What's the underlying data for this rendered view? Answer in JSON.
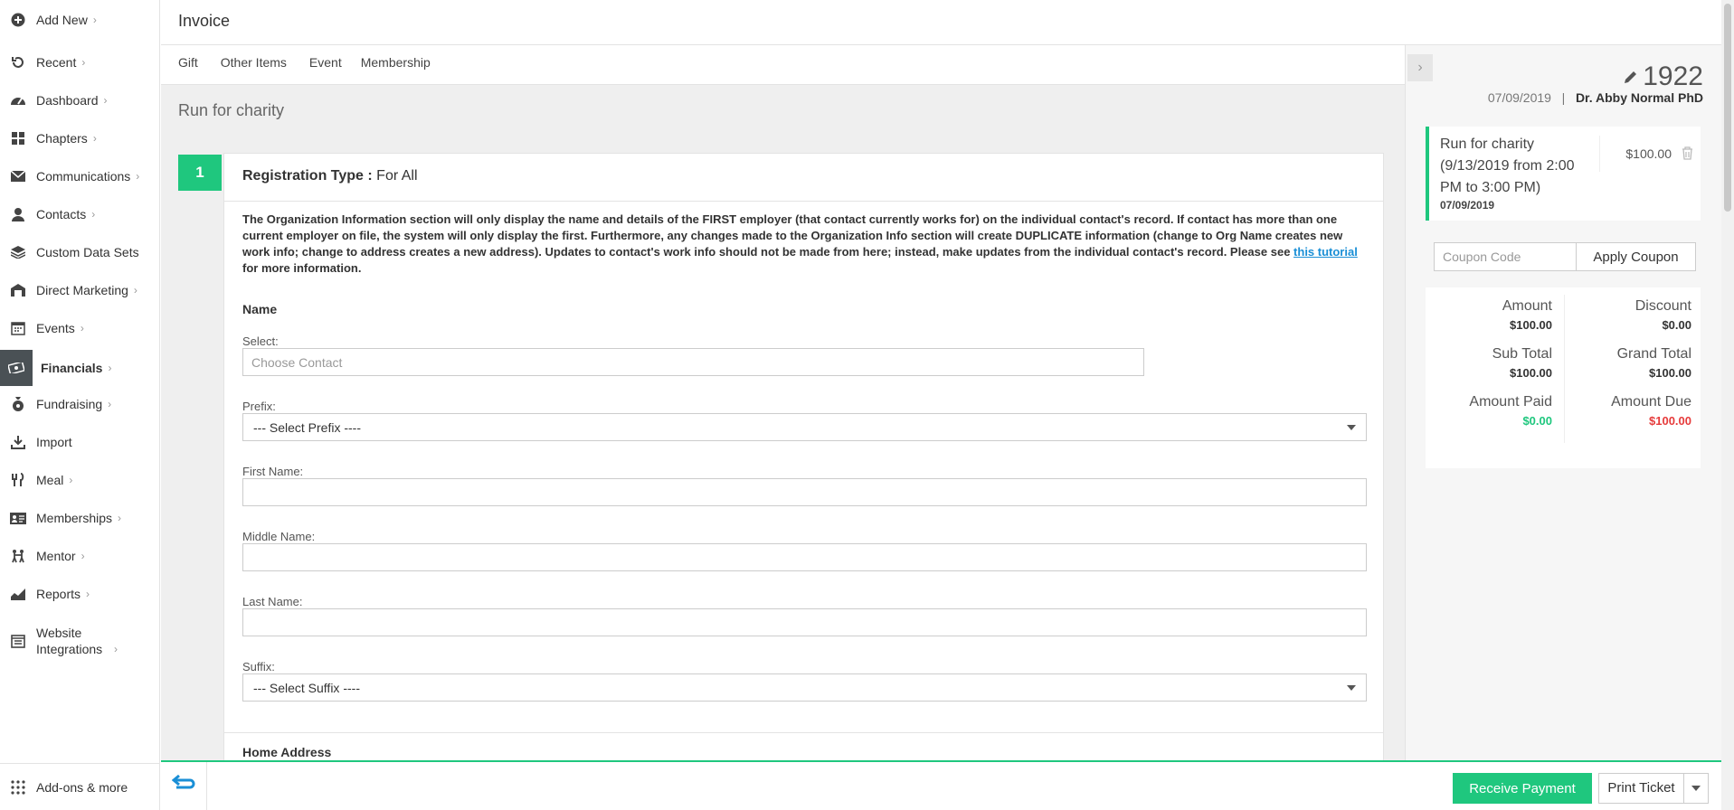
{
  "sidebar": {
    "items": [
      {
        "label": "Add New",
        "icon": "plus-circle-icon"
      },
      {
        "label": "Recent",
        "icon": "history-icon"
      },
      {
        "label": "Dashboard",
        "icon": "dashboard-icon"
      },
      {
        "label": "Chapters",
        "icon": "grid-icon"
      },
      {
        "label": "Communications",
        "icon": "envelope-icon"
      },
      {
        "label": "Contacts",
        "icon": "person-icon"
      },
      {
        "label": "Custom Data Sets",
        "icon": "layers-icon"
      },
      {
        "label": "Direct Marketing",
        "icon": "building-icon"
      },
      {
        "label": "Events",
        "icon": "calendar-icon"
      },
      {
        "label": "Financials",
        "icon": "money-icon"
      },
      {
        "label": "Fundraising",
        "icon": "moneybag-icon"
      },
      {
        "label": "Import",
        "icon": "import-icon"
      },
      {
        "label": "Meal",
        "icon": "utensils-icon"
      },
      {
        "label": "Memberships",
        "icon": "id-card-icon"
      },
      {
        "label": "Mentor",
        "icon": "mentor-icon"
      },
      {
        "label": "Reports",
        "icon": "chart-icon"
      },
      {
        "label": "Website Integrations",
        "icon": "website-icon"
      }
    ],
    "bottom_label": "Add-ons & more"
  },
  "header": {
    "title": "Invoice"
  },
  "tabs": [
    {
      "label": "Gift"
    },
    {
      "label": "Other Items"
    },
    {
      "label": "Event"
    },
    {
      "label": "Membership"
    }
  ],
  "main": {
    "event_title": "Run for charity",
    "step_number": "1",
    "registration_type_label": "Registration Type :",
    "registration_type_value": "For All",
    "notice_text": "The Organization Information section will only display the name and details of the FIRST employer (that contact currently works for) on the individual contact's record. If contact has more than one current employer on file, the system will only display the first. Furthermore, any changes made to the Organization Info section will create DUPLICATE information (change to Org Name creates new work info; change to address creates a new address). Updates to contact's work info should not be made from here; instead, make updates from the individual contact's record. Please see",
    "notice_link": "this tutorial",
    "notice_tail": "for more information.",
    "name_section": "Name",
    "select_label": "Select:",
    "select_placeholder": "Choose Contact",
    "prefix_label": "Prefix:",
    "prefix_value": "--- Select Prefix ----",
    "first_name_label": "First Name:",
    "middle_name_label": "Middle Name:",
    "last_name_label": "Last Name:",
    "suffix_label": "Suffix:",
    "suffix_value": "--- Select Suffix ----",
    "home_address_section": "Home Address"
  },
  "panel": {
    "invoice_number": "1922",
    "date": "07/09/2019",
    "separator": "|",
    "contact": "Dr. Abby Normal PhD",
    "item": {
      "name": "Run for charity (9/13/2019 from 2:00 PM to 3:00 PM)",
      "date": "07/09/2019",
      "price": "$100.00"
    },
    "coupon_placeholder": "Coupon Code",
    "apply_coupon": "Apply Coupon",
    "totals": {
      "amount_label": "Amount",
      "amount": "$100.00",
      "discount_label": "Discount",
      "discount": "$0.00",
      "subtotal_label": "Sub Total",
      "subtotal": "$100.00",
      "grandtotal_label": "Grand Total",
      "grandtotal": "$100.00",
      "paid_label": "Amount Paid",
      "paid": "$0.00",
      "due_label": "Amount Due",
      "due": "$100.00"
    }
  },
  "footer": {
    "receive_payment": "Receive Payment",
    "print_ticket": "Print Ticket"
  },
  "colors": {
    "accent": "#1fc77e",
    "danger": "#e63b3b",
    "link": "#1a8fd6"
  }
}
